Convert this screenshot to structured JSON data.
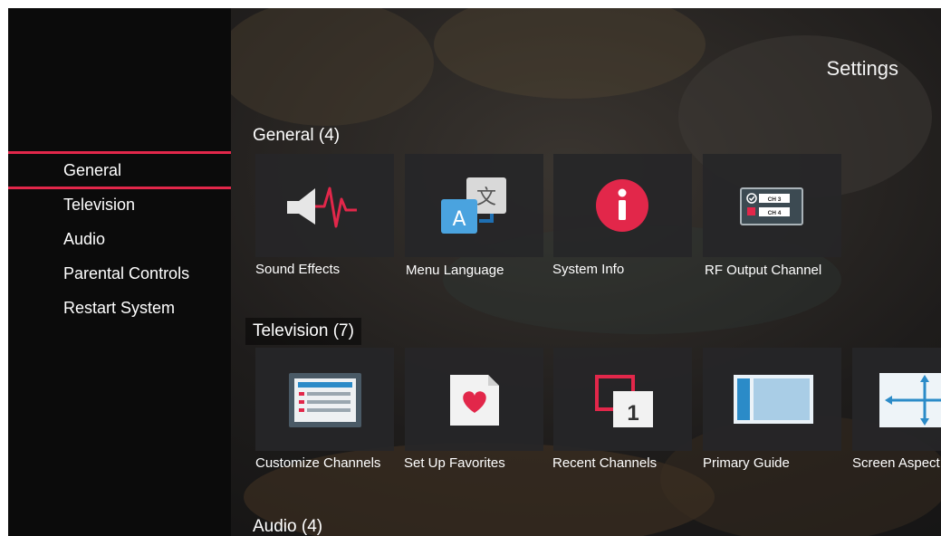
{
  "header": {
    "title": "Settings"
  },
  "sidebar": {
    "items": [
      {
        "label": "General",
        "selected": true
      },
      {
        "label": "Television",
        "selected": false
      },
      {
        "label": "Audio",
        "selected": false
      },
      {
        "label": "Parental Controls",
        "selected": false
      },
      {
        "label": "Restart System",
        "selected": false
      }
    ]
  },
  "sections": [
    {
      "title": "General (4)",
      "tiles": [
        {
          "label": "Sound Effects",
          "icon": "sound-effects-icon"
        },
        {
          "label": "Menu Language",
          "icon": "language-icon"
        },
        {
          "label": "System Info",
          "icon": "info-icon"
        },
        {
          "label": "RF Output Channel",
          "icon": "rf-output-icon",
          "icon_text": [
            "CH 3",
            "CH 4"
          ]
        }
      ]
    },
    {
      "title": "Television (7)",
      "tiles": [
        {
          "label": "Customize Channels",
          "icon": "channel-list-icon"
        },
        {
          "label": "Set Up Favorites",
          "icon": "favorites-heart-icon"
        },
        {
          "label": "Recent Channels",
          "icon": "recent-channels-icon",
          "icon_text": "1"
        },
        {
          "label": "Primary Guide",
          "icon": "guide-icon"
        },
        {
          "label": "Screen Aspect",
          "icon": "screen-aspect-icon"
        }
      ]
    },
    {
      "title": "Audio (4)"
    }
  ],
  "colors": {
    "accent": "#e2274a",
    "sidebar_bg": "#0b0b0b",
    "tile_bg": "#262628"
  }
}
